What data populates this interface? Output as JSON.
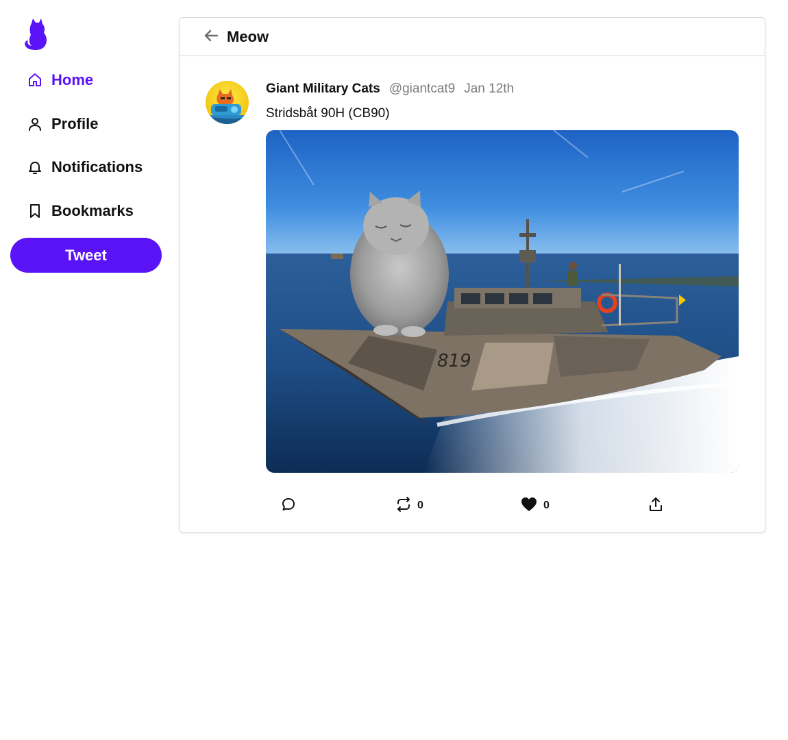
{
  "sidebar": {
    "nav": [
      {
        "label": "Home",
        "icon": "home-icon",
        "active": true
      },
      {
        "label": "Profile",
        "icon": "user-icon",
        "active": false
      },
      {
        "label": "Notifications",
        "icon": "bell-icon",
        "active": false
      },
      {
        "label": "Bookmarks",
        "icon": "bookmark-icon",
        "active": false
      }
    ],
    "tweet_button": "Tweet"
  },
  "header": {
    "title": "Meow"
  },
  "post": {
    "author": "Giant Military Cats",
    "handle": "@giantcat9",
    "date": "Jan 12th",
    "text": "Stridsbåt 90H (CB90)",
    "retweet_count": "0",
    "like_count": "0"
  },
  "colors": {
    "accent": "#5a12f7",
    "muted": "#7a7a7a",
    "border": "#d9d9d9"
  }
}
